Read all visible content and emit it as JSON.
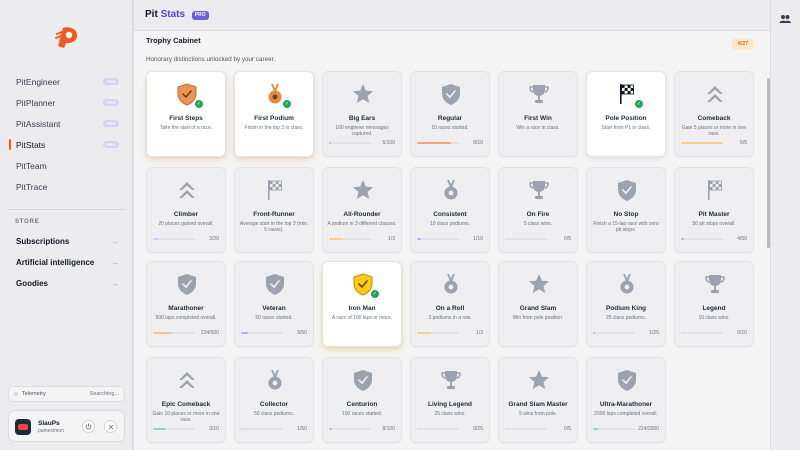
{
  "app": {
    "title_main": "Pit",
    "title_accent": "Stats",
    "title_badge": "PRO"
  },
  "sidebar": {
    "items": [
      {
        "label": "PitEngineer",
        "badge": "PRO",
        "active": false
      },
      {
        "label": "PitPlanner",
        "badge": "PRO",
        "active": false
      },
      {
        "label": "PitAssistant",
        "badge": "PRO",
        "active": false
      },
      {
        "label": "PitStats",
        "badge": "PRO",
        "active": true
      },
      {
        "label": "PitTeam",
        "badge": "",
        "active": false
      },
      {
        "label": "PitTrace",
        "badge": "",
        "active": false
      }
    ],
    "store_title": "STORE",
    "store_items": [
      {
        "label": "Subscriptions",
        "arrow": "→"
      },
      {
        "label": "Artificial intelligence",
        "arrow": "→"
      },
      {
        "label": "Goodies",
        "arrow": "→"
      }
    ],
    "telemetry": {
      "label": "Telemetry",
      "status": "Searching..."
    },
    "user": {
      "name": "SlauPs",
      "handle": "pamesimon",
      "icon1": "power-icon",
      "icon2": "close-icon"
    }
  },
  "section": {
    "title": "Trophy Cabinet",
    "subtitle": "Honorary distinctions unlocked by your career.",
    "count": "4/27"
  },
  "colors": {
    "accent": "#4f46e5",
    "brand": "#ef5a24",
    "unlocked_orange": "#ef8a3d",
    "unlocked_gold": "#eab308",
    "success": "#22a35a"
  },
  "trophies": [
    {
      "name": "First Steps",
      "desc": "Take the start of a race.",
      "icon": "shield-icon",
      "state": "orange",
      "progress": null,
      "fill": null
    },
    {
      "name": "First Podium",
      "desc": "Finish in the top 3 in class.",
      "icon": "medal-icon",
      "state": "orange",
      "progress": null,
      "fill": null
    },
    {
      "name": "Big Ears",
      "desc": "100 engineer messages captured.",
      "icon": "star-icon",
      "state": "locked",
      "progress": "5/100",
      "fill": 0.05
    },
    {
      "name": "Regular",
      "desc": "10 races started.",
      "icon": "shield-icon",
      "state": "locked",
      "progress": "8/10",
      "fill": 0.8
    },
    {
      "name": "First Win",
      "desc": "Win a race in class.",
      "icon": "cup-icon",
      "state": "locked",
      "progress": null,
      "fill": null
    },
    {
      "name": "Pole Position",
      "desc": "Start from P1 in class.",
      "icon": "flag-icon",
      "state": "unlocked",
      "progress": null,
      "fill": null
    },
    {
      "name": "Comeback",
      "desc": "Gain 5 places or more in one race.",
      "icon": "chevrons-up-icon",
      "state": "locked",
      "progress": "5/5",
      "fill": 1.0
    },
    {
      "name": "Climber",
      "desc": "20 places gained overall.",
      "icon": "chevrons-up-icon",
      "state": "locked",
      "progress": "3/20",
      "fill": 0.15
    },
    {
      "name": "Front-Runner",
      "desc": "Average start in the top 3 (min. 5 races).",
      "icon": "flag-icon",
      "state": "locked",
      "progress": null,
      "fill": null
    },
    {
      "name": "All-Rounder",
      "desc": "A podium in 3 different classes.",
      "icon": "star-icon",
      "state": "locked",
      "progress": "1/3",
      "fill": 0.33
    },
    {
      "name": "Consistent",
      "desc": "10 class podiums.",
      "icon": "medal-icon",
      "state": "locked",
      "progress": "1/10",
      "fill": 0.1
    },
    {
      "name": "On Fire",
      "desc": "5 class wins.",
      "icon": "cup-icon",
      "state": "locked",
      "progress": "0/5",
      "fill": 0.0
    },
    {
      "name": "No Stop",
      "desc": "Finish a 15-lap race with zero pit stops.",
      "icon": "shield-icon",
      "state": "locked",
      "progress": null,
      "fill": null
    },
    {
      "name": "Pit Master",
      "desc": "50 pit stops overall.",
      "icon": "flag-icon",
      "state": "locked",
      "progress": "4/50",
      "fill": 0.08
    },
    {
      "name": "Marathoner",
      "desc": "500 laps completed overall.",
      "icon": "shield-icon",
      "state": "locked",
      "progress": "224/500",
      "fill": 0.45
    },
    {
      "name": "Veteran",
      "desc": "50 races started.",
      "icon": "shield-icon",
      "state": "locked",
      "progress": "8/50",
      "fill": 0.16
    },
    {
      "name": "Iron Man",
      "desc": "A race of 100 laps or more.",
      "icon": "shield-icon",
      "state": "gold",
      "progress": null,
      "fill": null
    },
    {
      "name": "On a Roll",
      "desc": "3 podiums in a row.",
      "icon": "medal-icon",
      "state": "locked",
      "progress": "1/3",
      "fill": 0.33
    },
    {
      "name": "Grand Slam",
      "desc": "Win from pole position.",
      "icon": "star-icon",
      "state": "locked",
      "progress": null,
      "fill": null
    },
    {
      "name": "Podium King",
      "desc": "25 class podiums.",
      "icon": "medal-icon",
      "state": "locked",
      "progress": "1/25",
      "fill": 0.04
    },
    {
      "name": "Legend",
      "desc": "10 class wins.",
      "icon": "cup-icon",
      "state": "locked",
      "progress": "0/10",
      "fill": 0.0
    },
    {
      "name": "Epic Comeback",
      "desc": "Gain 10 places or more in one race.",
      "icon": "chevrons-up-icon",
      "state": "locked",
      "progress": "3/10",
      "fill": 0.3
    },
    {
      "name": "Collector",
      "desc": "50 class podiums.",
      "icon": "medal-icon",
      "state": "locked",
      "progress": "1/50",
      "fill": 0.02
    },
    {
      "name": "Centurion",
      "desc": "100 races started.",
      "icon": "shield-icon",
      "state": "locked",
      "progress": "8/100",
      "fill": 0.08
    },
    {
      "name": "Living Legend",
      "desc": "25 class wins.",
      "icon": "cup-icon",
      "state": "locked",
      "progress": "0/25",
      "fill": 0.0
    },
    {
      "name": "Grand Slam Master",
      "desc": "5 wins from pole.",
      "icon": "star-icon",
      "state": "locked",
      "progress": "0/5",
      "fill": 0.0
    },
    {
      "name": "Ultra-Marathoner",
      "desc": "2000 laps completed overall.",
      "icon": "shield-icon",
      "state": "locked",
      "progress": "224/2000",
      "fill": 0.11
    }
  ]
}
